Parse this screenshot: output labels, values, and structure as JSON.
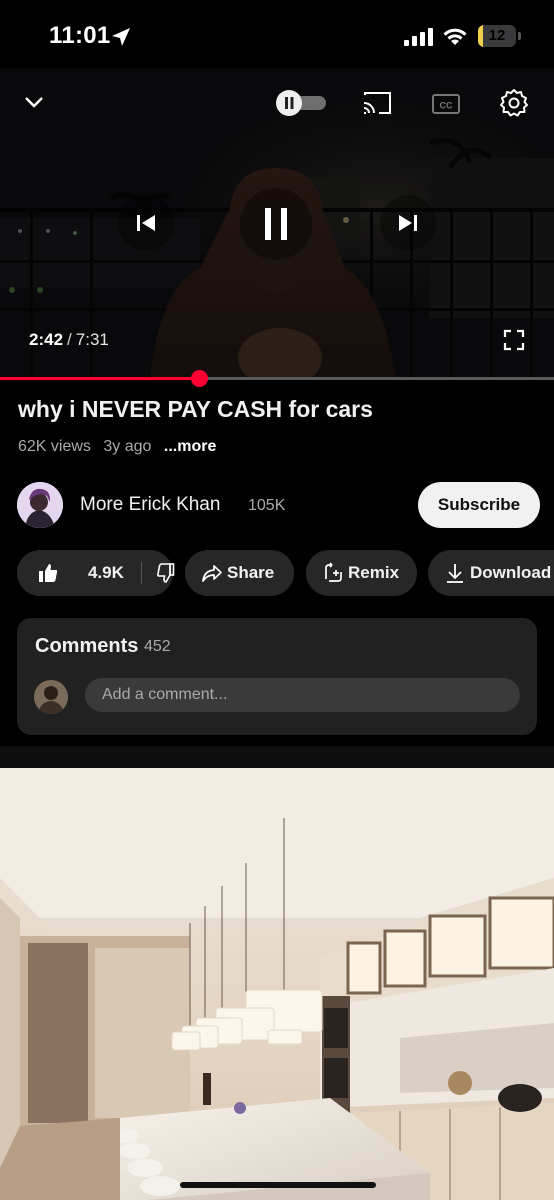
{
  "status_bar": {
    "time": "11:01",
    "battery_level": "12",
    "battery_fraction": 0.12
  },
  "player": {
    "current_time": "2:42",
    "separator": "/",
    "duration": "7:31",
    "progress_fraction": 0.359,
    "icons": [
      "chevron-down-icon",
      "pause-toggle-icon",
      "cast-icon",
      "captions-icon",
      "settings-icon",
      "previous-icon",
      "pause-icon",
      "next-icon",
      "fullscreen-icon"
    ]
  },
  "video": {
    "title": "why i NEVER PAY CASH for cars",
    "views": "62K views",
    "age": "3y ago",
    "more": "...more"
  },
  "channel": {
    "name": "More Erick Khan",
    "subscribers": "105K",
    "subscribe_label": "Subscribe"
  },
  "actions": {
    "likes": "4.9K",
    "share": "Share",
    "remix": "Remix",
    "download": "Download"
  },
  "comments": {
    "title": "Comments",
    "count": "452",
    "placeholder": "Add a comment..."
  },
  "colors": {
    "accent": "#ff0033",
    "pill_bg": "#272727",
    "card_bg": "#212121"
  }
}
